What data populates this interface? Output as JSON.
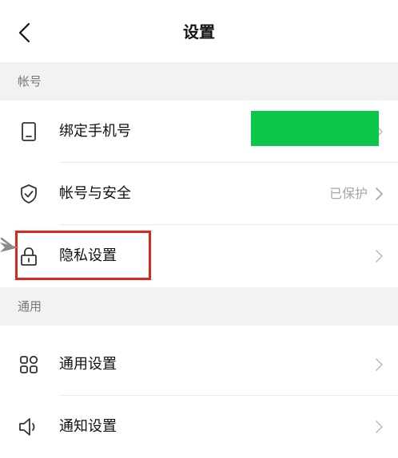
{
  "header": {
    "title": "设置",
    "back_icon": "chevron-left-icon"
  },
  "sections": [
    {
      "title": "帐号"
    },
    {
      "title": "通用"
    }
  ],
  "rows": {
    "bind_phone": {
      "label": "绑定手机号",
      "icon": "phone-icon"
    },
    "account_security": {
      "label": "帐号与安全",
      "value": "已保护",
      "icon": "shield-check-icon"
    },
    "privacy": {
      "label": "隐私设置",
      "icon": "lock-icon"
    },
    "general": {
      "label": "通用设置",
      "icon": "grid-icon"
    },
    "notification": {
      "label": "通知设置",
      "icon": "speaker-icon"
    }
  },
  "colors": {
    "redaction": "#0ac74a",
    "highlight_border": "#e0241e",
    "section_background": "#f2f2f2",
    "secondary_text": "#a6a6a6"
  }
}
